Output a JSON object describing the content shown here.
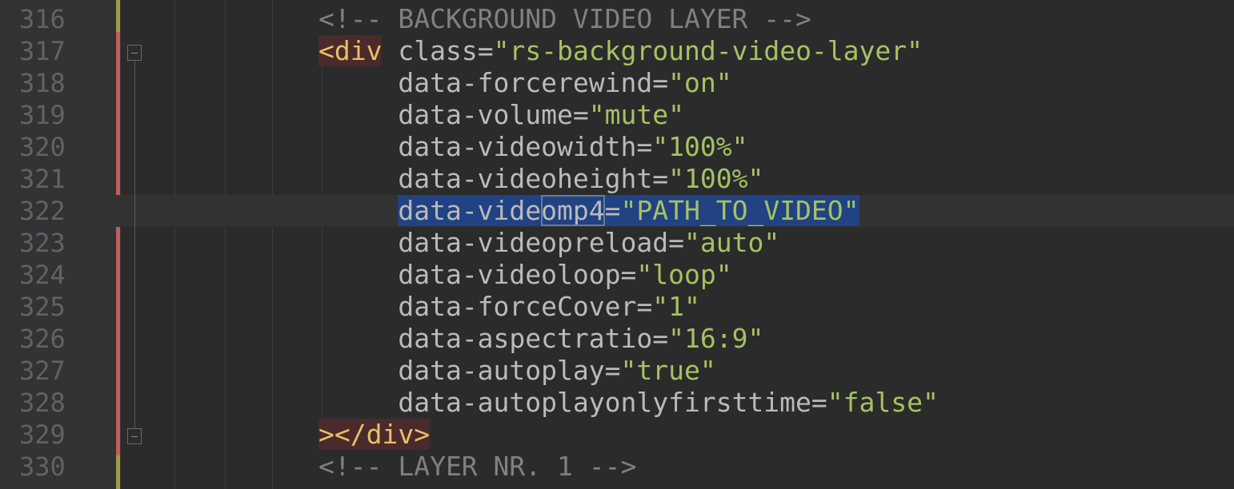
{
  "editor": {
    "lines": [
      {
        "num": "316",
        "kind": "comment",
        "text": "<!-- BACKGROUND VIDEO LAYER -->"
      },
      {
        "num": "317",
        "kind": "open",
        "tag": "<div",
        "attr": "class",
        "eq": "=",
        "val": "\"rs-background-video-layer\""
      },
      {
        "num": "318",
        "kind": "attr",
        "attr": "data-forcerewind",
        "eq": "=",
        "val": "\"on\""
      },
      {
        "num": "319",
        "kind": "attr",
        "attr": "data-volume",
        "eq": "=",
        "val": "\"mute\""
      },
      {
        "num": "320",
        "kind": "attr",
        "attr": "data-videowidth",
        "eq": "=",
        "val": "\"100%\""
      },
      {
        "num": "321",
        "kind": "attr",
        "attr": "data-videoheight",
        "eq": "=",
        "val": "\"100%\""
      },
      {
        "num": "322",
        "kind": "selected",
        "attr_a": "data-vide",
        "attr_b": "omp4",
        "eq": "=",
        "val": "\"PATH_TO_VIDEO\""
      },
      {
        "num": "323",
        "kind": "attr",
        "attr": "data-videopreload",
        "eq": "=",
        "val": "\"auto\""
      },
      {
        "num": "324",
        "kind": "attr",
        "attr": "data-videoloop",
        "eq": "=",
        "val": "\"loop\""
      },
      {
        "num": "325",
        "kind": "attr",
        "attr": "data-forceCover",
        "eq": "=",
        "val": "\"1\""
      },
      {
        "num": "326",
        "kind": "attr",
        "attr": "data-aspectratio",
        "eq": "=",
        "val": "\"16:9\""
      },
      {
        "num": "327",
        "kind": "attr",
        "attr": "data-autoplay",
        "eq": "=",
        "val": "\"true\""
      },
      {
        "num": "328",
        "kind": "attr",
        "attr": "data-autoplayonlyfirsttime",
        "eq": "=",
        "val": "\"false\""
      },
      {
        "num": "329",
        "kind": "close",
        "tag": "></div>"
      },
      {
        "num": "330",
        "kind": "comment",
        "text": "<!-- LAYER NR. 1 -->"
      }
    ]
  },
  "colors": {
    "background": "#2b2b2b",
    "comment": "#808080",
    "tag": "#e8bf6a",
    "attribute": "#bababa",
    "string": "#a5c261",
    "selection": "#214283",
    "line_number": "#606366"
  }
}
